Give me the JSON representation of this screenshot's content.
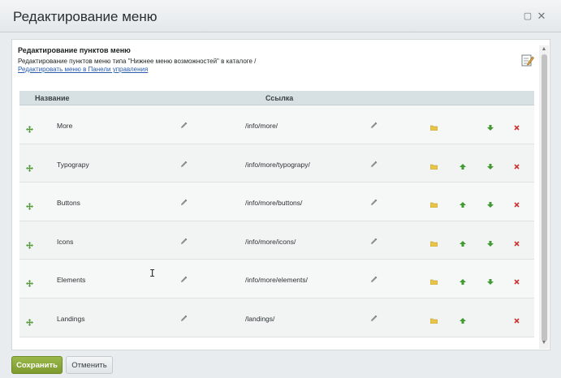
{
  "window": {
    "title": "Редактирование меню"
  },
  "header": {
    "title": "Редактирование пунктов меню",
    "description": "Редактирование пунктов меню типа \"Нижнее меню возможностей\" в каталоге /",
    "link": "Редактировать меню в Панели управления"
  },
  "table": {
    "col_name": "Название",
    "col_link": "Ссылка",
    "rows": [
      {
        "name": "More",
        "url": "/info/more/",
        "has_up": false,
        "has_down": true
      },
      {
        "name": "Typograpy",
        "url": "/info/more/typograpy/",
        "has_up": true,
        "has_down": true
      },
      {
        "name": "Buttons",
        "url": "/info/more/buttons/",
        "has_up": true,
        "has_down": true
      },
      {
        "name": "Icons",
        "url": "/info/more/icons/",
        "has_up": true,
        "has_down": true
      },
      {
        "name": "Elements",
        "url": "/info/more/elements/",
        "has_up": true,
        "has_down": true
      },
      {
        "name": "Landings",
        "url": "/landings/",
        "has_up": true,
        "has_down": false
      }
    ]
  },
  "footer": {
    "save_label": "Сохранить",
    "cancel_label": "Отменить"
  },
  "colors": {
    "save": "#8aa93a",
    "delete": "#d0312d",
    "arrow": "#3f9a2f",
    "folder": "#e8c547",
    "link": "#2a5db0"
  },
  "icons": [
    "maximize-icon",
    "close-icon",
    "edit-menu-icon",
    "drag-handle-icon",
    "pencil-icon",
    "folder-icon",
    "arrow-up-icon",
    "arrow-down-icon",
    "delete-icon",
    "text-cursor-icon"
  ]
}
